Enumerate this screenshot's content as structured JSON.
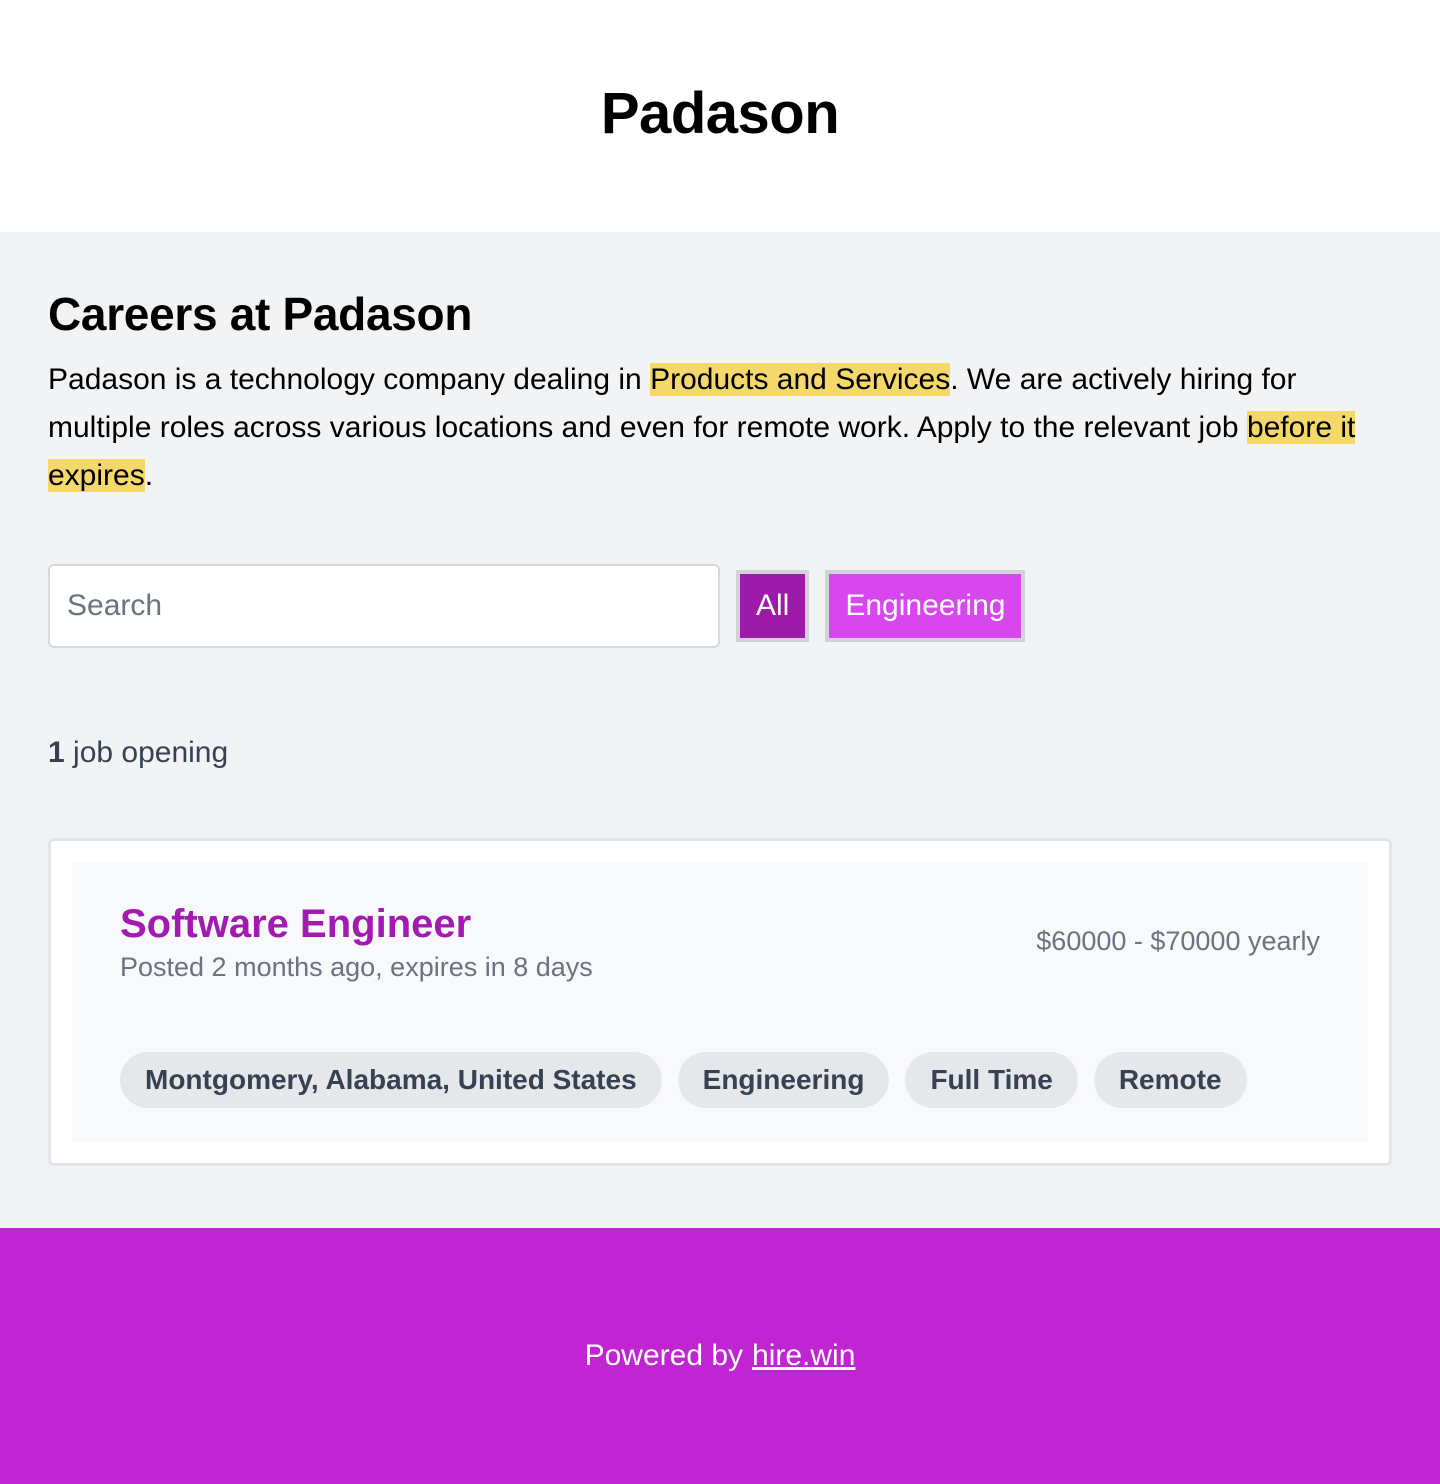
{
  "header": {
    "brand": "Padason"
  },
  "intro": {
    "title": "Careers at Padason",
    "text_1": "Padason is a technology company dealing in ",
    "highlight_1": "Products and Services",
    "text_2": ". We are actively hiring for multiple roles across various locations and even for remote work. Apply to the relevant job ",
    "highlight_2": "before it expires",
    "text_3": "."
  },
  "filters": {
    "search_placeholder": "Search",
    "search_value": "",
    "buttons": [
      {
        "label": "All",
        "color": "#9e1aa8"
      },
      {
        "label": "Engineering",
        "color": "#d846ee"
      }
    ]
  },
  "jobs_count": {
    "number": "1",
    "label": " job opening"
  },
  "jobs": [
    {
      "title": "Software Engineer",
      "meta": "Posted 2 months ago, expires in 8 days",
      "salary": "$60000 - $70000 yearly",
      "tags": [
        "Montgomery, Alabama, United States",
        "Engineering",
        "Full Time",
        "Remote"
      ]
    }
  ],
  "footer": {
    "prefix": "Powered by",
    "link_label": "hire.win"
  },
  "colors": {
    "accent": "#c124d3",
    "title_purple": "#a31ab0",
    "highlight": "#f5d86a",
    "page_bg": "#f2f3f5"
  }
}
